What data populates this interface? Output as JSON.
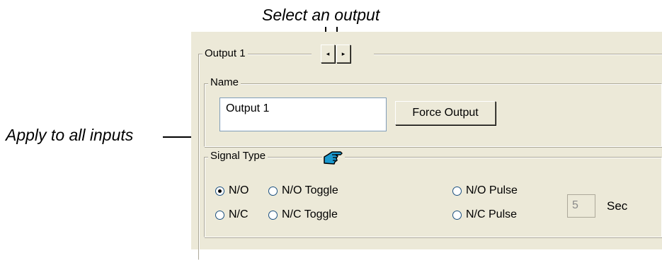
{
  "callouts": {
    "select_output": "Select an output",
    "apply_all": "Apply to all inputs"
  },
  "output_group": {
    "label": "Output 1",
    "prev_glyph": "◂",
    "next_glyph": "▸"
  },
  "name_group": {
    "legend": "Name",
    "name_value": "Output 1",
    "force_button": "Force Output"
  },
  "signal_group": {
    "legend": "Signal Type",
    "apply_icon": "pointing-hand-icon",
    "options": {
      "no": {
        "label": "N/O",
        "selected": true
      },
      "no_toggle": {
        "label": "N/O Toggle",
        "selected": false
      },
      "no_pulse": {
        "label": "N/O Pulse",
        "selected": false
      },
      "nc": {
        "label": "N/C",
        "selected": false
      },
      "nc_toggle": {
        "label": "N/C Toggle",
        "selected": false
      },
      "nc_pulse": {
        "label": "N/C Pulse",
        "selected": false
      }
    },
    "pulse_seconds": "5",
    "pulse_unit": "Sec"
  },
  "colors": {
    "panel": "#ece9d8",
    "icon_blue": "#1a9ad0"
  }
}
